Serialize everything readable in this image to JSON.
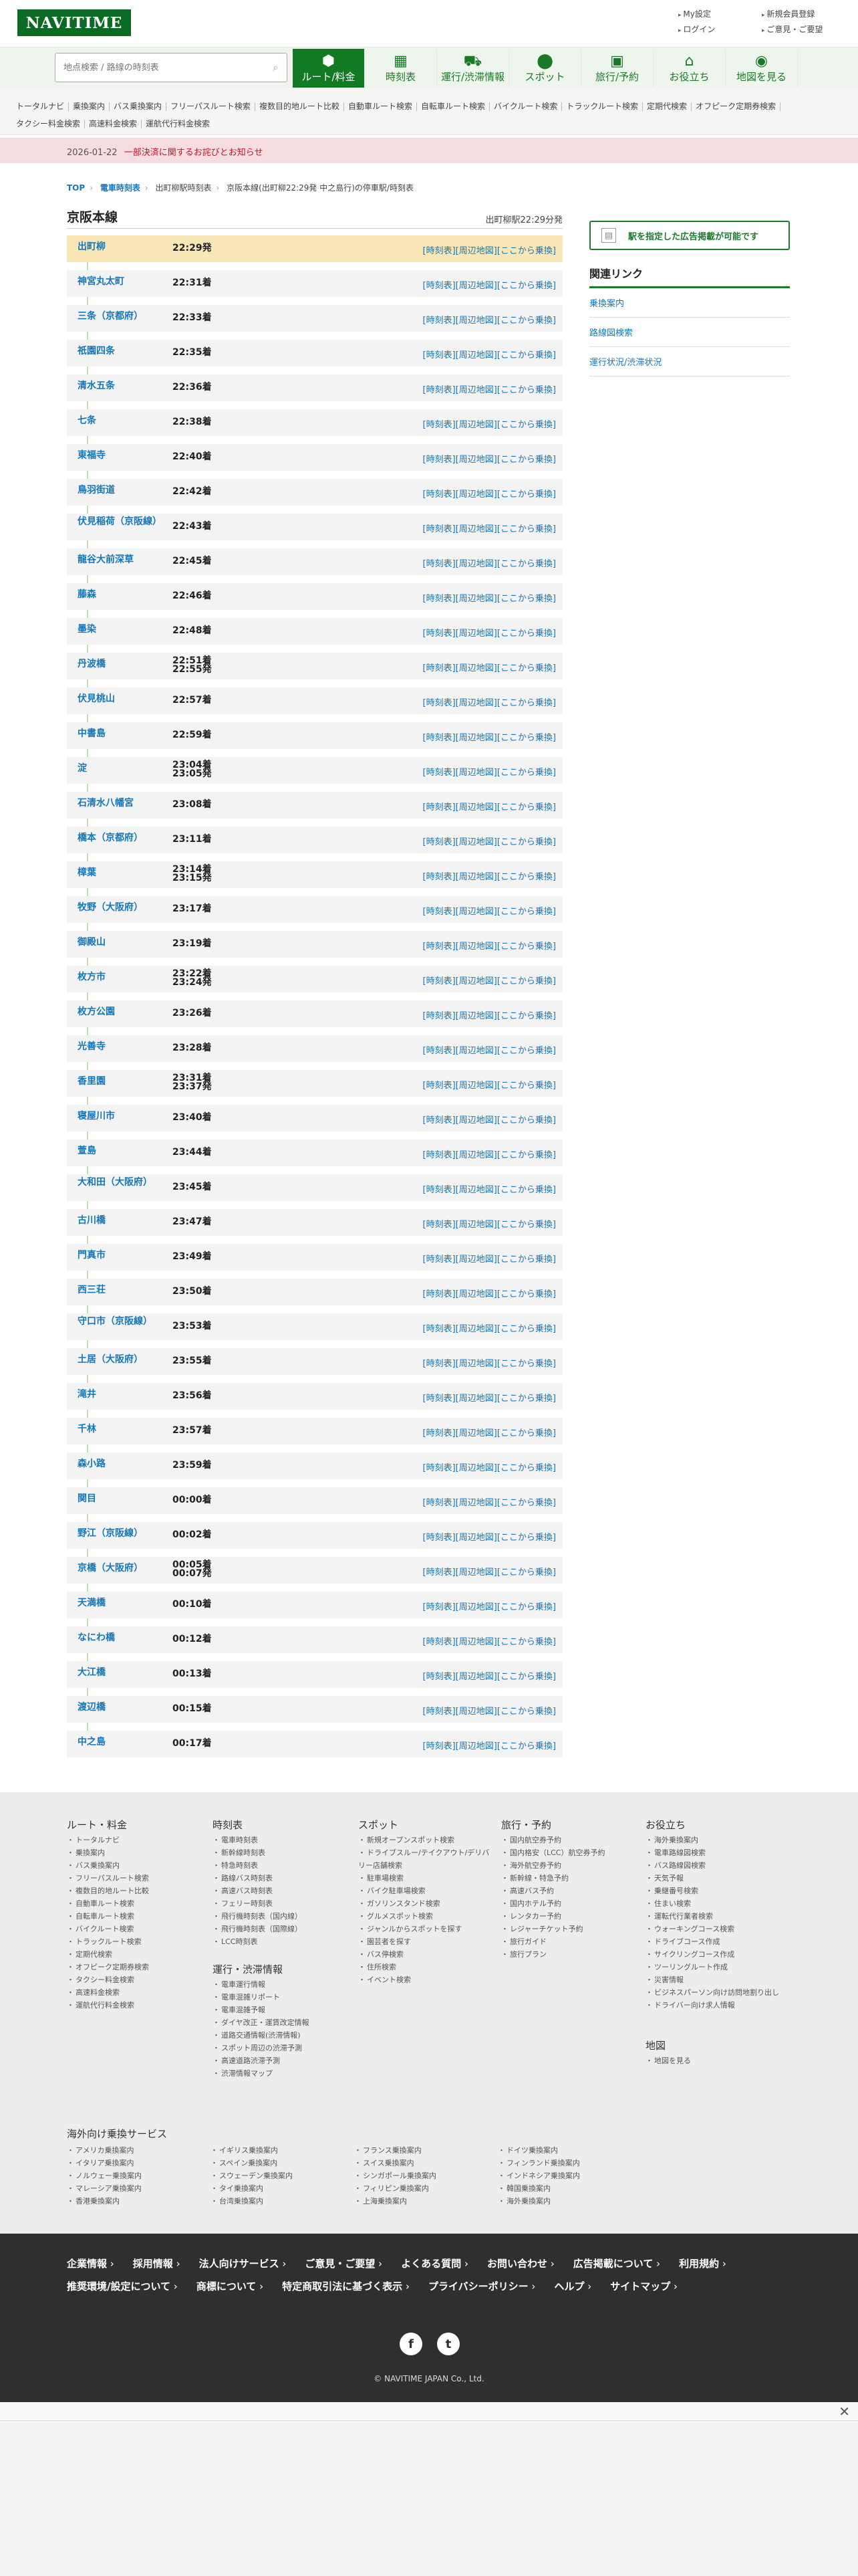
{
  "header": {
    "logo": "NAVITIME",
    "top_links": [
      "My設定",
      "新規会員登録",
      "ログイン",
      "ご意見・ご要望"
    ]
  },
  "nav": {
    "search_placeholder": "地点検索 / 路線の時刻表",
    "tabs": [
      {
        "label": "ルート/料金",
        "icon": "route-icon"
      },
      {
        "label": "時刻表",
        "icon": "calendar-icon"
      },
      {
        "label": "運行/渋滞情報",
        "icon": "traffic-icon"
      },
      {
        "label": "スポット",
        "icon": "pin-icon"
      },
      {
        "label": "旅行/予約",
        "icon": "suitcase-icon"
      },
      {
        "label": "お役立ち",
        "icon": "house-icon"
      },
      {
        "label": "地図を見る",
        "icon": "map-icon"
      }
    ],
    "active_tab": 0
  },
  "subnav": [
    "トータルナビ",
    "乗換案内",
    "バス乗換案内",
    "フリーパスルート検索",
    "複数目的地ルート比較",
    "自動車ルート検索",
    "自転車ルート検索",
    "バイクルート検索",
    "トラックルート検索",
    "定期代検索",
    "オフピーク定期券検索",
    "タクシー料金検索",
    "高速料金検索",
    "運航代行料金検索"
  ],
  "notice": {
    "date": "2026-01-22",
    "text": "一部決済に関するお詫びとお知らせ"
  },
  "breadcrumb": [
    "TOP",
    "電車時刻表",
    "出町柳駅時刻表",
    "京阪本線(出町柳22:29発 中之島行)の停車駅/時刻表"
  ],
  "section": {
    "title": "京阪本線",
    "subtitle": "出町柳駅22:29分発"
  },
  "row_links": [
    "時刻表",
    "周辺地図",
    "ここから乗換"
  ],
  "stops": [
    {
      "name": "出町柳",
      "time": "22:29発",
      "time2": ""
    },
    {
      "name": "神宮丸太町",
      "time": "22:31着",
      "time2": ""
    },
    {
      "name": "三条（京都府）",
      "time": "22:33着",
      "time2": ""
    },
    {
      "name": "祇園四条",
      "time": "22:35着",
      "time2": ""
    },
    {
      "name": "清水五条",
      "time": "22:36着",
      "time2": ""
    },
    {
      "name": "七条",
      "time": "22:38着",
      "time2": ""
    },
    {
      "name": "東福寺",
      "time": "22:40着",
      "time2": ""
    },
    {
      "name": "鳥羽街道",
      "time": "22:42着",
      "time2": ""
    },
    {
      "name": "伏見稲荷（京阪線）",
      "time": "22:43着",
      "time2": ""
    },
    {
      "name": "龍谷大前深草",
      "time": "22:45着",
      "time2": ""
    },
    {
      "name": "藤森",
      "time": "22:46着",
      "time2": ""
    },
    {
      "name": "墨染",
      "time": "22:48着",
      "time2": ""
    },
    {
      "name": "丹波橋",
      "time": "22:51着",
      "time2": "22:55発"
    },
    {
      "name": "伏見桃山",
      "time": "22:57着",
      "time2": ""
    },
    {
      "name": "中書島",
      "time": "22:59着",
      "time2": ""
    },
    {
      "name": "淀",
      "time": "23:04着",
      "time2": "23:05発"
    },
    {
      "name": "石清水八幡宮",
      "time": "23:08着",
      "time2": ""
    },
    {
      "name": "橋本（京都府）",
      "time": "23:11着",
      "time2": ""
    },
    {
      "name": "樟葉",
      "time": "23:14着",
      "time2": "23:15発"
    },
    {
      "name": "牧野（大阪府）",
      "time": "23:17着",
      "time2": ""
    },
    {
      "name": "御殿山",
      "time": "23:19着",
      "time2": ""
    },
    {
      "name": "枚方市",
      "time": "23:22着",
      "time2": "23:24発"
    },
    {
      "name": "枚方公園",
      "time": "23:26着",
      "time2": ""
    },
    {
      "name": "光善寺",
      "time": "23:28着",
      "time2": ""
    },
    {
      "name": "香里園",
      "time": "23:31着",
      "time2": "23:37発"
    },
    {
      "name": "寝屋川市",
      "time": "23:40着",
      "time2": ""
    },
    {
      "name": "萱島",
      "time": "23:44着",
      "time2": ""
    },
    {
      "name": "大和田（大阪府）",
      "time": "23:45着",
      "time2": ""
    },
    {
      "name": "古川橋",
      "time": "23:47着",
      "time2": ""
    },
    {
      "name": "門真市",
      "time": "23:49着",
      "time2": ""
    },
    {
      "name": "西三荘",
      "time": "23:50着",
      "time2": ""
    },
    {
      "name": "守口市（京阪線）",
      "time": "23:53着",
      "time2": ""
    },
    {
      "name": "土居（大阪府）",
      "time": "23:55着",
      "time2": ""
    },
    {
      "name": "滝井",
      "time": "23:56着",
      "time2": ""
    },
    {
      "name": "千林",
      "time": "23:57着",
      "time2": ""
    },
    {
      "name": "森小路",
      "time": "23:59着",
      "time2": ""
    },
    {
      "name": "関目",
      "time": "00:00着",
      "time2": ""
    },
    {
      "name": "野江（京阪線）",
      "time": "00:02着",
      "time2": ""
    },
    {
      "name": "京橋（大阪府）",
      "time": "00:05着",
      "time2": "00:07発"
    },
    {
      "name": "天満橋",
      "time": "00:10着",
      "time2": ""
    },
    {
      "name": "なにわ橋",
      "time": "00:12着",
      "time2": ""
    },
    {
      "name": "大江橋",
      "time": "00:13着",
      "time2": ""
    },
    {
      "name": "渡辺橋",
      "time": "00:15着",
      "time2": ""
    },
    {
      "name": "中之島",
      "time": "00:17着",
      "time2": ""
    }
  ],
  "side": {
    "ad_text": "駅を指定した広告掲載が可能です",
    "related_title": "関連リンク",
    "related": [
      "乗換案内",
      "路線図検索",
      "運行状況/渋滞状況"
    ]
  },
  "footer": {
    "columns": [
      {
        "title": "ルート・料金",
        "items": [
          "トータルナビ",
          "乗換案内",
          "バス乗換案内",
          "フリーパスルート検索",
          "複数目的地ルート比較",
          "自動車ルート検索",
          "自転車ルート検索",
          "バイクルート検索",
          "トラックルート検索",
          "定期代検索",
          "オフピーク定期券検索",
          "タクシー料金検索",
          "高速料金検索",
          "運航代行料金検索"
        ]
      },
      {
        "title": "時刻表",
        "items": [
          "電車時刻表",
          "新幹線時刻表",
          "特急時刻表",
          "路線バス時刻表",
          "高速バス時刻表",
          "フェリー時刻表",
          "飛行機時刻表（国内線）",
          "飛行機時刻表（国際線）",
          "LCC時刻表"
        ]
      },
      {
        "title": "運行・渋滞情報",
        "items": [
          "電車運行情報",
          "電車混雑リポート",
          "電車混雑予報",
          "ダイヤ改正・運賃改定情報",
          "道路交通情報(渋滞情報)",
          "スポット周辺の渋滞予測",
          "高速道路渋滞予測",
          "渋滞情報マップ"
        ]
      },
      {
        "title": "スポット",
        "items": [
          "新規オープンスポット検索",
          "ドライブスルー/テイクアウト/デリバリー店舗検索",
          "駐車場検索",
          "バイク駐車場検索",
          "ガソリンスタンド検索",
          "グルメスポット検索",
          "ジャンルからスポットを探す",
          "園芸者を探す",
          "バス停検索",
          "住所検索",
          "イベント検索"
        ]
      },
      {
        "title": "旅行・予約",
        "items": [
          "国内航空券予約",
          "国内格安（LCC）航空券予約",
          "海外航空券予約",
          "新幹線・特急予約",
          "高速バス予約",
          "国内ホテル予約",
          "レンタカー予約",
          "レジャーチケット予約",
          "旅行ガイド",
          "旅行プラン"
        ]
      },
      {
        "title": "お役立ち",
        "items": [
          "海外乗換案内",
          "電車路線図検索",
          "バス路線図検索",
          "天気予報",
          "乗継番号検索",
          "住まい検索",
          "運転代行業者検索",
          "ウォーキングコース検索",
          "ドライブコース作成",
          "サイクリングコース作成",
          "ツーリングルート作成",
          "災害情報",
          "ビジネスパーソン向け訪問地割り出し",
          "ドライバー向け求人情報"
        ]
      },
      {
        "title": "地図",
        "items": [
          "地図を見る"
        ]
      }
    ],
    "overseas_title": "海外向け乗換サービス",
    "overseas": [
      "アメリカ乗換案内",
      "イギリス乗換案内",
      "フランス乗換案内",
      "ドイツ乗換案内",
      "イタリア乗換案内",
      "スペイン乗換案内",
      "スイス乗換案内",
      "フィンランド乗換案内",
      "ノルウェー乗換案内",
      "スウェーデン乗換案内",
      "シンガポール乗換案内",
      "インドネシア乗換案内",
      "マレーシア乗換案内",
      "タイ乗換案内",
      "フィリピン乗換案内",
      "韓国乗換案内",
      "香港乗換案内",
      "台湾乗換案内",
      "上海乗換案内",
      "海外乗換案内"
    ]
  },
  "bottom": {
    "links": [
      "企業情報",
      "採用情報",
      "法人向けサービス",
      "ご意見・ご要望",
      "よくある質問",
      "お問い合わせ",
      "広告掲載について",
      "利用規約",
      "推奨環境/設定について",
      "商標について",
      "特定商取引法に基づく表示",
      "プライバシーポリシー",
      "ヘルプ",
      "サイトマップ"
    ],
    "social": [
      "facebook-icon",
      "twitter-icon"
    ],
    "copyright": "© NAVITIME JAPAN Co., Ltd."
  }
}
